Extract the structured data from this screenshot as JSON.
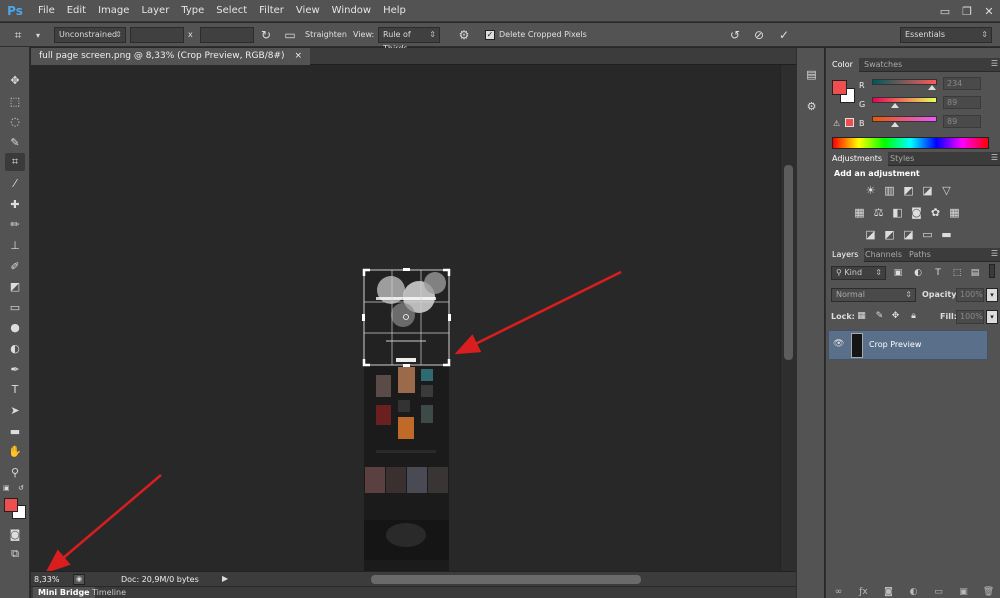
{
  "app": {
    "logo": "Ps"
  },
  "menu": [
    "File",
    "Edit",
    "Image",
    "Layer",
    "Type",
    "Select",
    "Filter",
    "View",
    "Window",
    "Help"
  ],
  "window_controls": {
    "minimize": "▭",
    "restore": "❐",
    "close": "✕"
  },
  "options": {
    "ratio_preset": "Unconstrained",
    "ratio_width": "",
    "ratio_separator": "x",
    "ratio_height": "",
    "straighten_label": "Straighten",
    "view_label": "View:",
    "view_overlay": "Rule of Thirds",
    "delete_cropped_label": "Delete Cropped Pixels",
    "delete_cropped_checked": true,
    "workspace": "Essentials"
  },
  "document": {
    "tab_title": "full page screen.png @ 8,33% (Crop Preview, RGB/8#)",
    "close": "×"
  },
  "status": {
    "zoom": "8,33%",
    "doc_info": "Doc: 20,9M/0 bytes"
  },
  "bottom_tabs": [
    "Mini Bridge",
    "Timeline"
  ],
  "color_panel": {
    "tabs": [
      "Color",
      "Swatches"
    ],
    "foreground": "#ef4e4e",
    "background": "#ffffff",
    "channels": [
      {
        "label": "R",
        "value": "234",
        "fraction": 0.92
      },
      {
        "label": "G",
        "value": "89",
        "fraction": 0.35
      },
      {
        "label": "B",
        "value": "89",
        "fraction": 0.35
      }
    ]
  },
  "adjustments_panel": {
    "tabs": [
      "Adjustments",
      "Styles"
    ],
    "title": "Add an adjustment"
  },
  "layers_panel": {
    "tabs": [
      "Layers",
      "Channels",
      "Paths"
    ],
    "filter_kind": "Kind",
    "blend_mode": "Normal",
    "opacity_label": "Opacity:",
    "opacity_value": "100%",
    "lock_label": "Lock:",
    "fill_label": "Fill:",
    "fill_value": "100%",
    "layers": [
      {
        "name": "Crop Preview",
        "visible": true
      }
    ]
  },
  "colors": {
    "chrome": "#535353",
    "canvas": "#282828",
    "selected_layer": "#5a6f8a",
    "arrow": "#d81e1e"
  }
}
